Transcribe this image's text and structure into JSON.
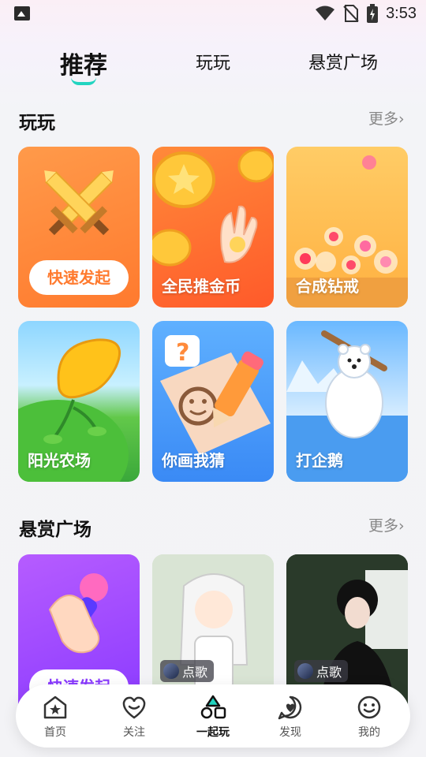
{
  "status_bar": {
    "time": "3:53"
  },
  "top_tabs": [
    {
      "label": "推荐",
      "active": true
    },
    {
      "label": "玩玩",
      "active": false
    },
    {
      "label": "悬赏广场",
      "active": false
    }
  ],
  "section_play": {
    "title": "玩玩",
    "more": "更多›",
    "cards": [
      {
        "label": "快速发起",
        "color": "#ff8a3d"
      },
      {
        "label": "全民推金币",
        "color": "#ff6a3a"
      },
      {
        "label": "合成钻戒",
        "color": "#ffb24a"
      },
      {
        "label": "阳光农场",
        "color": "#4caf3a"
      },
      {
        "label": "你画我猜",
        "color": "#3f9cff"
      },
      {
        "label": "打企鹅",
        "color": "#4a9cf0"
      }
    ]
  },
  "section_bounty": {
    "title": "悬赏广场",
    "more": "更多›",
    "cards": [
      {
        "label": "快速发起",
        "color": "#a646ff"
      },
      {
        "tag": "点歌"
      },
      {
        "tag": "点歌"
      }
    ]
  },
  "bottom_nav": [
    {
      "label": "首页",
      "icon": "home-icon"
    },
    {
      "label": "关注",
      "icon": "heart-icon"
    },
    {
      "label": "一起玩",
      "icon": "play-together-icon",
      "active": true
    },
    {
      "label": "发现",
      "icon": "discover-icon"
    },
    {
      "label": "我的",
      "icon": "profile-icon"
    }
  ],
  "colors": {
    "accent": "#21d4c0",
    "nav_bg": "#ffffff"
  }
}
